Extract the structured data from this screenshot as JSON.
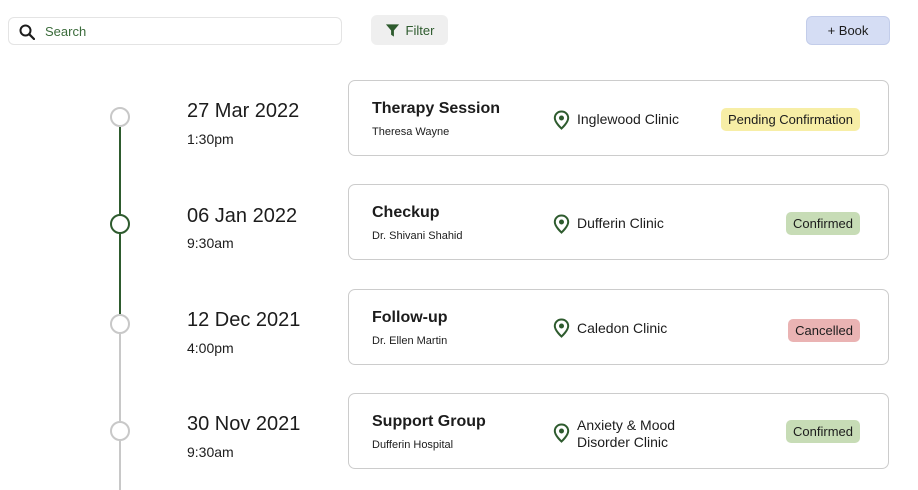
{
  "search": {
    "placeholder": "Search",
    "value": ""
  },
  "toolbar": {
    "filter_label": "Filter",
    "book_label": "+ Book"
  },
  "colors": {
    "accent": "#2e5b2e",
    "pending_bg": "#f7eea6",
    "confirmed_bg": "#c7dcb6",
    "cancelled_bg": "#eab3b3",
    "book_bg": "#d5ddf4"
  },
  "appointments": [
    {
      "date": "27 Mar 2022",
      "time": "1:30pm",
      "title": "Therapy Session",
      "person": "Theresa Wayne",
      "location": "Inglewood Clinic",
      "status": "Pending Confirmation",
      "status_type": "pending"
    },
    {
      "date": "06 Jan 2022",
      "time": "9:30am",
      "title": "Checkup",
      "person": "Dr. Shivani Shahid",
      "location": "Dufferin Clinic",
      "status": "Confirmed",
      "status_type": "confirmed"
    },
    {
      "date": "12 Dec 2021",
      "time": "4:00pm",
      "title": "Follow-up",
      "person": "Dr. Ellen Martin",
      "location": "Caledon Clinic",
      "status": "Cancelled",
      "status_type": "cancelled"
    },
    {
      "date": "30 Nov 2021",
      "time": "9:30am",
      "title": "Support Group",
      "person": "Dufferin Hospital",
      "location": "Anxiety & Mood Disorder Clinic",
      "location_line1": "Anxiety & Mood",
      "location_line2": "Disorder Clinic",
      "status": "Confirmed",
      "status_type": "confirmed"
    }
  ]
}
